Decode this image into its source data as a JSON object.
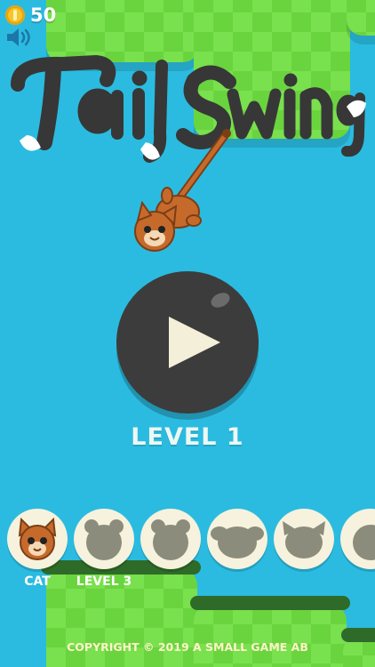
{
  "hud": {
    "coins": "50",
    "coin_icon": "coin-icon",
    "sound_icon": "speaker-icon"
  },
  "logo": {
    "text": "TailSwing"
  },
  "play": {
    "icon": "play-icon"
  },
  "level": {
    "label": "LEVEL 1"
  },
  "characters": {
    "items": [
      {
        "name": "cat",
        "label": "CAT",
        "selected": true
      },
      {
        "name": "bear",
        "label": "LEVEL 3",
        "locked": true
      },
      {
        "name": "bear-2",
        "label": "",
        "locked": true
      },
      {
        "name": "mouse",
        "label": "",
        "locked": true
      },
      {
        "name": "wolf",
        "label": "",
        "locked": true
      },
      {
        "name": "next",
        "label": "",
        "locked": true
      }
    ]
  },
  "footer": {
    "copyright": "COPYRIGHT © 2019 A SMALL GAME AB"
  },
  "colors": {
    "sky": "#2bbbe0",
    "grass": "#79e04e",
    "grass_dark": "#2f6b28",
    "button": "#3c3c3c",
    "play_icon": "#f3efd8",
    "logo": "#373737",
    "cat": "#c66a2c"
  }
}
